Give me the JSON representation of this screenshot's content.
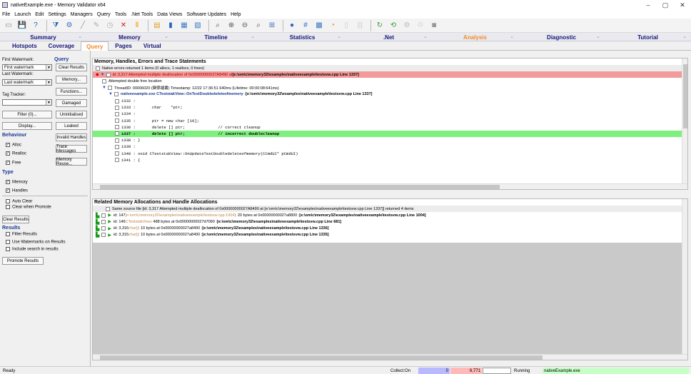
{
  "window": {
    "title": "nativeExample.exe - Memory Validator x64",
    "minimize": "–",
    "maximize": "▢",
    "close": "✕"
  },
  "menu": [
    "File",
    "Launch",
    "Edit",
    "Settings",
    "Managers",
    "Query",
    "Tools",
    ".Net Tools",
    "Data Views",
    "Software Updates",
    "Help"
  ],
  "toolbar_icons": [
    "new-icon",
    "save-icon",
    "help-icon",
    "filter-icon",
    "settings-icon",
    "brush-icon",
    "pen-icon",
    "timer-icon",
    "stop-icon",
    "pause-icon",
    "folder-icon",
    "chart-icon",
    "snapshot-icon",
    "compare-icon",
    "search-icon",
    "zoom-in-icon",
    "zoom-out-icon",
    "find-icon",
    "network-icon",
    "drop-icon",
    "hex-icon",
    "memory-icon",
    "pie-icon",
    "printer-icon",
    "bars-icon",
    "refresh-green-icon",
    "loop-green-icon",
    "gear-gray-icon",
    "recycle-icon",
    "camera-icon"
  ],
  "nav_tabs": [
    "Summary",
    "Memory",
    "Timeline",
    "Statistics",
    ".Net",
    "Analysis",
    "Diagnostic",
    "Tutorial"
  ],
  "nav_active": "Analysis",
  "sub_tabs": [
    "Hotspots",
    "Coverage",
    "Query",
    "Pages",
    "Virtual"
  ],
  "sub_active": "Query",
  "left": {
    "first_watermark_label": "First Watermark:",
    "first_watermark_value": "First watermark",
    "query_head": "Query",
    "clear_results": "Clear Results",
    "last_watermark_label": "Last Watermark:",
    "last_watermark_value": "Last watermark",
    "memory_btn": "Memory...",
    "functions_btn": "Functions...",
    "tag_tracker_label": "Tag Tracker:",
    "damaged_btn": "Damaged",
    "filter_btn": "Filter (0)...",
    "uninitialised_btn": "Uninitialised",
    "display_btn": "Display...",
    "leaked_btn": "Leaked",
    "behaviour_head": "Behaviour",
    "invalid_handles_btn": "Invalid Handles",
    "alloc": "Alloc",
    "trace_messages_btn": "Trace Messages",
    "realloc": "Realloc",
    "free": "Free",
    "memory_reuse_btn": "Memory Reuse...",
    "type_head": "Type",
    "memory": "Memory",
    "handles": "Handles",
    "auto_clear": "Auto Clear",
    "clear_when_promote": "Clear when Promote",
    "clear_results2": "Clear Results",
    "results_head": "Results",
    "filter_results": "Filter Results",
    "use_watermarks": "Use Watermarks on Results",
    "include_search": "Include search in results",
    "promote_results": "Promote Results"
  },
  "top": {
    "title": "Memory, Handles, Errors and Trace Statements",
    "rows": [
      {
        "indent": 0,
        "style": "gray",
        "text": "Native errors returned 1 items (0 allocs, 1 reallocs, 0 frees)"
      },
      {
        "indent": 0,
        "style": "red",
        "text": "id: 3,317 Attempted multiple deallocation of 0x00000000027A8490 at ",
        "bold": "[e:\\om\\c\\memory32\\examples\\nativeexample\\testsvw.cpp Line 1337]"
      },
      {
        "indent": 1,
        "style": "",
        "text": "Attempted double free location"
      },
      {
        "indent": 1,
        "style": "",
        "text": "ThreadID: 00006020 (関係諸書) Timestamp: 12/22 17:36:51 640ms (Lifetime: 00:00:08:641ms)"
      },
      {
        "indent": 2,
        "style": "",
        "blue": "nativeexample.exe CTeststakView::OnTestDoubledeleteofmemory : ",
        "bold": "[e:\\om\\c\\memory32\\examples\\nativeexample\\testsvw.cpp Line 1337]"
      },
      {
        "indent": 3,
        "style": "",
        "code": "1332 :"
      },
      {
        "indent": 3,
        "style": "",
        "code": "1333 :       char    *ptr;"
      },
      {
        "indent": 3,
        "style": "",
        "code": "1334 :"
      },
      {
        "indent": 3,
        "style": "",
        "code": "1335 :       ptr = new char [10];"
      },
      {
        "indent": 3,
        "style": "",
        "code": "1336 :       delete [] ptr;              // correct cleanup"
      },
      {
        "indent": 3,
        "style": "green",
        "code": "1337 :       delete [] ptr;              // incorrect doublecleanup",
        "codebold": true
      },
      {
        "indent": 3,
        "style": "",
        "code": "1338 : }"
      },
      {
        "indent": 3,
        "style": "",
        "code": "1339 :"
      },
      {
        "indent": 3,
        "style": "",
        "code": "1340 : void CTeststakView::OnUpdateTestDoubledeleteofmemory(CCmdUI* pCmdUI)"
      },
      {
        "indent": 3,
        "style": "",
        "code": "1341 : {"
      }
    ]
  },
  "bottom": {
    "title": "Related Memory Allocations and Handle Allocations",
    "rows": [
      {
        "style": "gray",
        "text": "Same source file [id: 3,317 Attempted multiple deallocation of 0x00000000027A8490 at [e:\\om\\c\\memory32\\examples\\nativeexample\\testsvw.cpp Line 1337]] returned 4 items"
      },
      {
        "style": "",
        "pre": "id: 147 ",
        "orange": "[e:\\om\\c\\memory32\\examples\\nativeexample\\testsvw.cpp:1004]",
        "mid": " : 20 bytes at 0x00000000027a8800 : ",
        "bold": "[e:\\om\\c\\memory32\\examples\\nativeexample\\testsvw.cpp Line 1004]"
      },
      {
        "style": "",
        "pre": "id: 146 ",
        "orange": "CTeststakView",
        "mid": " : 488 bytes at 0x00000000027d7090 : ",
        "bold": "[e:\\om\\c\\memory32\\examples\\nativeexample\\testsvw.cpp Line 681]"
      },
      {
        "style": "",
        "pre": "id: 3,316 ",
        "orange": "char[]",
        "mid": " : 10 bytes at 0x00000000027a8490 : ",
        "bold": "[e:\\om\\c\\memory32\\examples\\nativeexample\\testsvw.cpp Line 1336]"
      },
      {
        "style": "",
        "pre": "id: 3,315 ",
        "orange": "char[]",
        "mid": " : 10 bytes at 0x00000000027a8490 : ",
        "bold": "[e:\\om\\c\\memory32\\examples\\nativeexample\\testsvw.cpp Line 1335]"
      }
    ]
  },
  "status": {
    "ready": "Ready",
    "collect": "Collect:On",
    "count1": "0",
    "count2": "6,771",
    "running": "Running",
    "process": "nativeExample.exe"
  }
}
